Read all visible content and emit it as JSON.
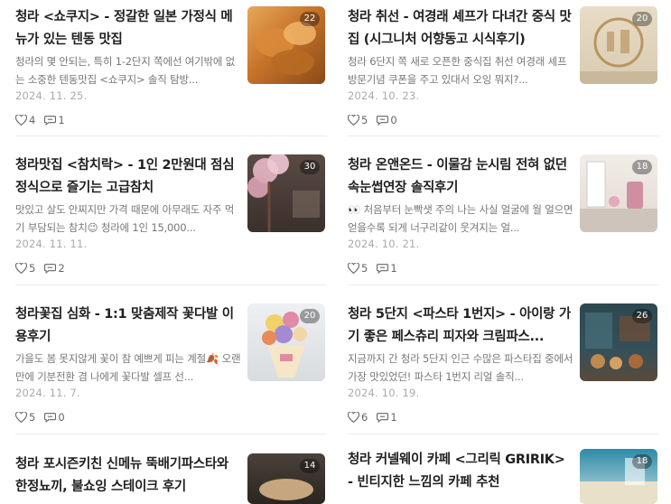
{
  "posts": [
    {
      "title": "청라 <쇼쿠지> - 정갈한 일본 가정식 메뉴가 있는 텐동 맛집",
      "excerpt": "청라의 몇 안되는, 특히 1-2단지 쪽에선 여기밖에 없는 소중한 텐동맛집 <쇼쿠지> 솔직 탐방...",
      "date": "2024. 11. 25.",
      "likes": "4",
      "comments": "1",
      "photo_count": "22",
      "thumb_colors": [
        "#c7742a",
        "#e7a85a"
      ]
    },
    {
      "title": "청라 취선 - 여경래 셰프가 다녀간 중식 맛집 (시그니처 어향동고 시식후기)",
      "excerpt": "청라 6단지 쪽 새로 오픈한 중식집 취선 여경래 셰프 방문기념 쿠폰을 주고 있대서 오잉 뭐지?...",
      "date": "2024. 10. 23.",
      "likes": "5",
      "comments": "0",
      "photo_count": "20",
      "thumb_colors": [
        "#d9cbb3",
        "#b9955f"
      ]
    },
    {
      "title": "청라맛집 <참치락> - 1인 2만원대 점심 정식으로 즐기는 고급참치",
      "excerpt": "맛있고 살도 안찌지만 가격 때문에 아무래도 자주 먹기 부담되는 참치😉 청라에 1인 15,000...",
      "date": "2024. 11. 11.",
      "likes": "5",
      "comments": "2",
      "photo_count": "30",
      "thumb_colors": [
        "#e8b8c8",
        "#4a3e39"
      ]
    },
    {
      "title": "청라 온앤온드 - 이물감 눈시림 전혀 없던 속눈썹연장 솔직후기",
      "excerpt": "👀 처음부터 눈빡샛 주의 나는 사실 얼굴에 월 얼으면 얻을수록 되게 너구리같이 웃겨지는 얼...",
      "date": "2024. 10. 21.",
      "likes": "5",
      "comments": "1",
      "photo_count": "18",
      "thumb_colors": [
        "#ece6e1",
        "#d08ea2"
      ]
    },
    {
      "title": "청라꽃집 심화 - 1:1 맞춤제작 꽃다발 이용후기",
      "excerpt": "가을도 봄 못지않게 꽃이 참 예쁘게 피는 계절🍂 오랜만에 기분전환 겸 나에게 꽃다발 셀프 선...",
      "date": "2024. 11. 7.",
      "likes": "5",
      "comments": "0",
      "photo_count": "20",
      "thumb_colors": [
        "#f2d7a6",
        "#e08aa3"
      ]
    },
    {
      "title": "청라 5단지 <파스타 1번지> - 아이랑 가기 좋은 페스츄리 피자와 크림파스...",
      "excerpt": "지금까지 간 청라 5단지 인근 수많은 파스타집 중에서 가장 맛있었던! 파스타 1번지 리얼 솔직...",
      "date": "2024. 10. 19.",
      "likes": "6",
      "comments": "1",
      "photo_count": "26",
      "thumb_colors": [
        "#34505a",
        "#c0894e"
      ]
    },
    {
      "title": "청라 포시즌키친 신메뉴 뚝배기파스타와 한정뇨끼, 불쇼잉 스테이크 후기",
      "excerpt": "",
      "date": "",
      "likes": "",
      "comments": "",
      "photo_count": "14",
      "thumb_colors": [
        "#3a3530",
        "#d6b48a"
      ]
    },
    {
      "title": "청라 커넬웨이 카페 <그리릭 GRIRIK> - 빈티지한 느낌의 카페 추천",
      "excerpt": "",
      "date": "",
      "likes": "",
      "comments": "",
      "photo_count": "18",
      "thumb_colors": [
        "#2f8aa8",
        "#e8e0c8"
      ]
    }
  ],
  "icons": {
    "like": "heart-icon",
    "comment": "comment-bubble-icon"
  },
  "colors": {
    "text": "#1f1f1f",
    "muted": "#777777",
    "date": "#aaaaaa"
  }
}
